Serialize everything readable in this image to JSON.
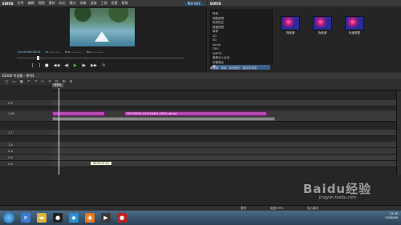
{
  "player": {
    "app_name": "EDIUS",
    "menu": [
      "文件",
      "编辑",
      "视图",
      "素材",
      "标记",
      "模式",
      "采集",
      "渲染",
      "工具",
      "设置",
      "帮助"
    ],
    "badge": "PLR REC",
    "timecodes": [
      "Cur 00:00:05:21",
      "In --:--:--:--",
      "Out --:--:--:--",
      "Dur --:--:--:--"
    ]
  },
  "bin": {
    "title": "EDIUS",
    "tree_items": [
      "特效",
      "视频滤镜",
      "色彩校正",
      "音频滤镜",
      "转场",
      "2D",
      "3D",
      "Alpha",
      "GPU",
      "SMPTE",
      "音频淡入淡出",
      "字幕混合",
      "键"
    ],
    "tree_footer": [
      "素材库",
      "特效",
      "序列标记",
      "源文件浏览"
    ],
    "effects": [
      "亮度键",
      "色度键",
      "轨道遮罩"
    ]
  },
  "timeline": {
    "title": "EDIUS 专业版 - 序列1",
    "sequence_tab": "序列1",
    "tracks": [
      "2 V",
      "1 VA",
      "1 T",
      "1 A",
      "2 A",
      "3 A",
      "4 A"
    ],
    "clip_label": "20170294_141150441_0924_a0.avi",
    "tooltip": "00:00:07:12"
  },
  "status": [
    "暂停",
    "磁盘:59%",
    "插入模式"
  ],
  "taskbar": {
    "clock": "23:36",
    "date": "2018/9/6"
  },
  "watermark": {
    "main": "Baidu经验",
    "url": "jingyan.baidu.com"
  }
}
